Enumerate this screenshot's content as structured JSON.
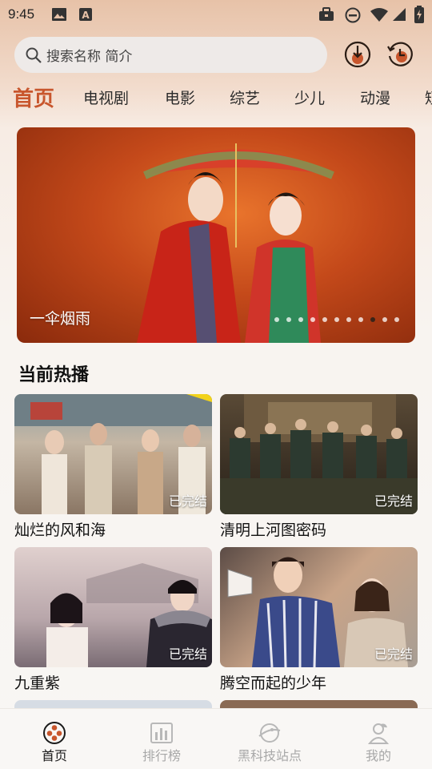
{
  "status_bar": {
    "time": "9:45",
    "icons": [
      "gallery-icon",
      "font-notification-icon",
      "briefcase-icon",
      "dnd-icon",
      "wifi-icon",
      "signal-icon",
      "battery-charging-icon"
    ]
  },
  "search": {
    "placeholder": "搜索名称 简介",
    "icon": "search-icon"
  },
  "header_buttons": [
    "download-icon",
    "history-icon"
  ],
  "tabs": [
    "首页",
    "电视剧",
    "电影",
    "综艺",
    "少儿",
    "动漫",
    "短剧"
  ],
  "active_tab": 0,
  "banner": {
    "title": "一伞烟雨",
    "slide_count": 11,
    "active_slide": 8
  },
  "section": {
    "title": "当前热播"
  },
  "cards": [
    {
      "title": "灿烂的风和海",
      "badge": "已完结"
    },
    {
      "title": "清明上河图密码",
      "badge": "已完结"
    },
    {
      "title": "九重紫",
      "badge": "已完结"
    },
    {
      "title": "腾空而起的少年",
      "badge": "已完结"
    }
  ],
  "bottom_nav": [
    {
      "label": "首页",
      "icon": "film-reel-icon",
      "active": true
    },
    {
      "label": "排行榜",
      "icon": "chart-icon",
      "active": false
    },
    {
      "label": "黑科技站点",
      "icon": "planet-icon",
      "active": false
    },
    {
      "label": "我的",
      "icon": "profile-icon",
      "active": false
    }
  ],
  "colors": {
    "accent": "#c8562d",
    "header_gradient_top": "#e7c2a8"
  }
}
